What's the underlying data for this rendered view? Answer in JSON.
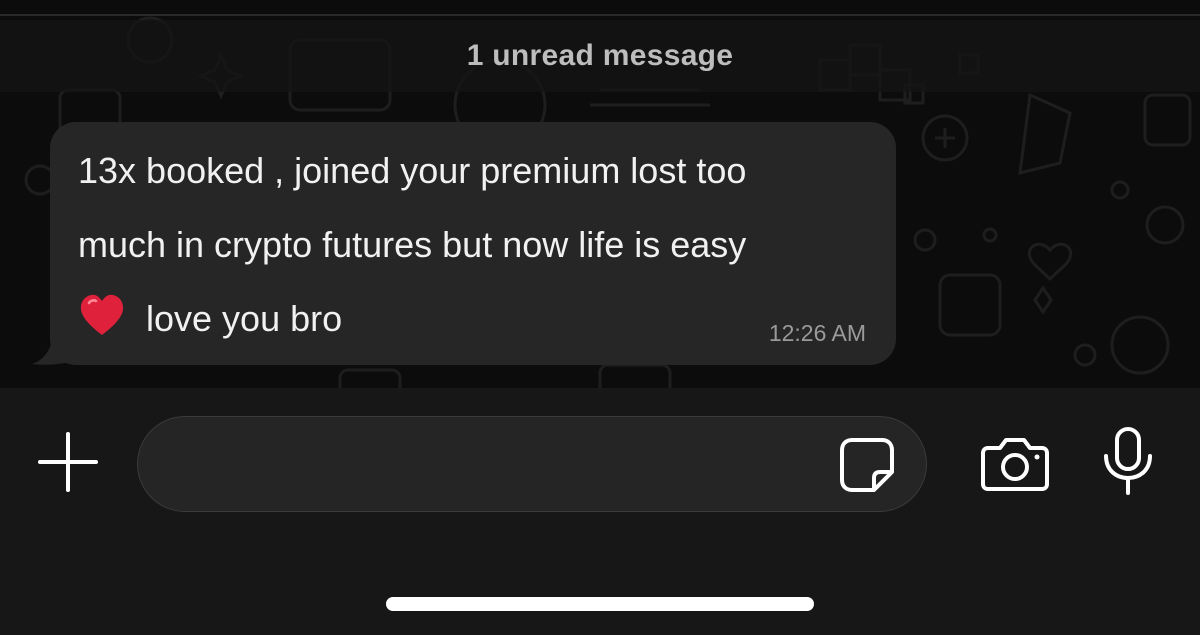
{
  "banner": {
    "unread_text": "1 unread message"
  },
  "message": {
    "lines": [
      "13x booked , joined your premium lost too",
      "much in crypto futures but now life is easy",
      "love you bro"
    ],
    "emoji": "heart",
    "time": "12:26 AM"
  },
  "composer": {
    "icons": [
      "plus-icon",
      "sticker-icon",
      "camera-icon",
      "microphone-icon"
    ]
  },
  "colors": {
    "background": "#0c0c0c",
    "bubble": "#262626",
    "input_bar": "#171717",
    "text": "#f1f1f1",
    "timestamp": "#9a9a9a",
    "heart": "#e0213c"
  }
}
